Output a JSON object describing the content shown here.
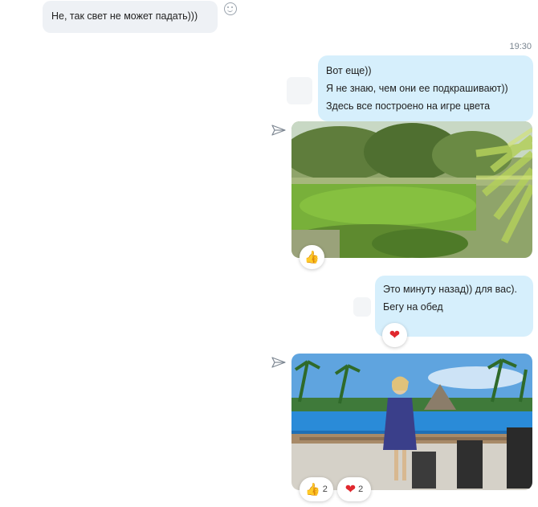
{
  "messages": {
    "incoming_text": "Не, так свет не может падать)))",
    "timestamp": "19:30",
    "outgoing_1": [
      "Вот еще))",
      "Я не знаю, чем они ее подкрашивают))",
      "Здесь все построено на игре цвета"
    ],
    "outgoing_2": [
      "Это минуту назад)) для вас).",
      "Бегу на обед"
    ]
  },
  "reactions": {
    "photo1": [
      {
        "icon": "thumbs-up-icon",
        "count": ""
      }
    ],
    "message2": [
      {
        "icon": "heart-icon",
        "count": ""
      }
    ],
    "photo2": [
      {
        "icon": "thumbs-up-icon",
        "count": "2"
      },
      {
        "icon": "heart-icon",
        "count": "2"
      }
    ]
  },
  "colors": {
    "incoming_bubble": "#eef1f5",
    "outgoing_bubble": "#d6effc",
    "heart": "#e0282e",
    "thumb": "#f6b93a"
  }
}
